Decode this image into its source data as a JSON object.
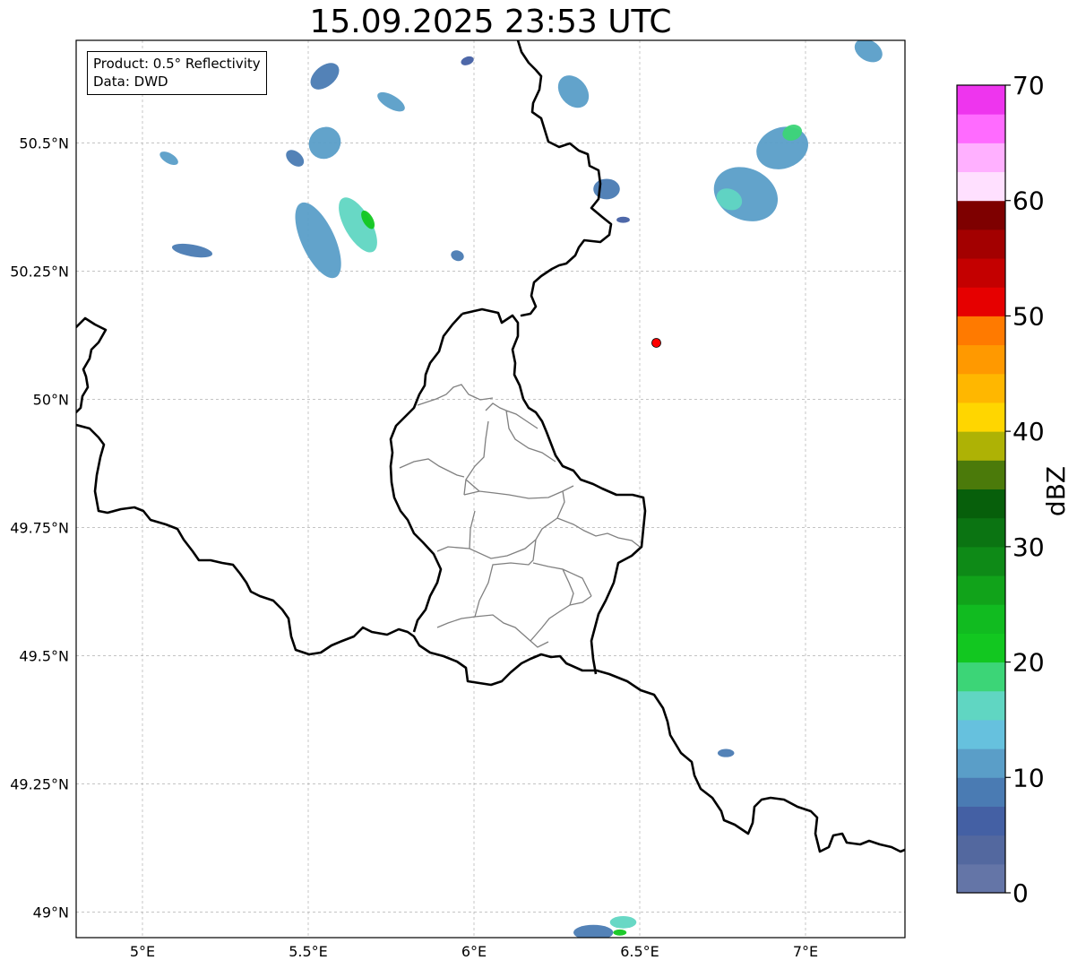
{
  "title": "15.09.2025 23:53 UTC",
  "info_box": {
    "product": "Product: 0.5° Reflectivity",
    "data_source": "Data: DWD"
  },
  "map": {
    "extent": {
      "lon_min": 4.8,
      "lon_max": 7.3,
      "lat_min": 48.95,
      "lat_max": 50.7
    },
    "lat_ticks": [
      {
        "value": 49.0,
        "label": "49°N"
      },
      {
        "value": 49.25,
        "label": "49.25°N"
      },
      {
        "value": 49.5,
        "label": "49.5°N"
      },
      {
        "value": 49.75,
        "label": "49.75°N"
      },
      {
        "value": 50.0,
        "label": "50°N"
      },
      {
        "value": 50.25,
        "label": "50.25°N"
      },
      {
        "value": 50.5,
        "label": "50.5°N"
      }
    ],
    "lon_ticks": [
      {
        "value": 5.0,
        "label": "5°E"
      },
      {
        "value": 5.5,
        "label": "5.5°E"
      },
      {
        "value": 6.0,
        "label": "6°E"
      },
      {
        "value": 6.5,
        "label": "6.5°E"
      },
      {
        "value": 7.0,
        "label": "7°E"
      }
    ],
    "radar_site": {
      "lon": 6.55,
      "lat": 50.11,
      "color": "#ff0000"
    },
    "colors": {
      "border": "#000000",
      "admin_border": "#808080",
      "grid": "#b0b0b0"
    },
    "echoes": [
      {
        "lon": 5.08,
        "lat": 50.47,
        "rlon": 0.015,
        "rlat": 0.02,
        "rot": -60,
        "dbz": 10
      },
      {
        "lon": 5.15,
        "lat": 50.29,
        "rlon": 0.018,
        "rlat": 0.04,
        "rot": -80,
        "dbz": 8
      },
      {
        "lon": 5.46,
        "lat": 50.47,
        "rlon": 0.02,
        "rlat": 0.02,
        "rot": -50,
        "dbz": 9
      },
      {
        "lon": 5.55,
        "lat": 50.5,
        "rlon": 0.05,
        "rlat": 0.03,
        "rot": -45,
        "dbz": 12
      },
      {
        "lon": 5.53,
        "lat": 50.31,
        "rlon": 0.05,
        "rlat": 0.08,
        "rot": -25,
        "dbz": 11
      },
      {
        "lon": 5.65,
        "lat": 50.34,
        "rlon": 0.04,
        "rlat": 0.06,
        "rot": -30,
        "dbz": 15
      },
      {
        "lon": 5.68,
        "lat": 50.35,
        "rlon": 0.015,
        "rlat": 0.02,
        "rot": -30,
        "dbz": 22
      },
      {
        "lon": 5.55,
        "lat": 50.63,
        "rlon": 0.05,
        "rlat": 0.02,
        "rot": -40,
        "dbz": 8
      },
      {
        "lon": 5.75,
        "lat": 50.58,
        "rlon": 0.02,
        "rlat": 0.03,
        "rot": -60,
        "dbz": 12
      },
      {
        "lon": 5.98,
        "lat": 50.66,
        "rlon": 0.02,
        "rlat": 0.008,
        "rot": -20,
        "dbz": 7
      },
      {
        "lon": 5.95,
        "lat": 50.28,
        "rlon": 0.02,
        "rlat": 0.01,
        "rot": 20,
        "dbz": 8
      },
      {
        "lon": 6.3,
        "lat": 50.6,
        "rlon": 0.04,
        "rlat": 0.035,
        "rot": -40,
        "dbz": 10
      },
      {
        "lon": 6.4,
        "lat": 50.41,
        "rlon": 0.04,
        "rlat": 0.02,
        "rot": 0,
        "dbz": 9
      },
      {
        "lon": 6.45,
        "lat": 50.35,
        "rlon": 0.02,
        "rlat": 0.006,
        "rot": 0,
        "dbz": 6
      },
      {
        "lon": 6.82,
        "lat": 50.4,
        "rlon": 0.1,
        "rlat": 0.05,
        "rot": 25,
        "dbz": 10
      },
      {
        "lon": 6.77,
        "lat": 50.39,
        "rlon": 0.04,
        "rlat": 0.02,
        "rot": 25,
        "dbz": 16
      },
      {
        "lon": 6.93,
        "lat": 50.49,
        "rlon": 0.08,
        "rlat": 0.04,
        "rot": -20,
        "dbz": 11
      },
      {
        "lon": 6.96,
        "lat": 50.52,
        "rlon": 0.03,
        "rlat": 0.015,
        "rot": -20,
        "dbz": 18
      },
      {
        "lon": 7.19,
        "lat": 50.68,
        "rlon": 0.045,
        "rlat": 0.02,
        "rot": 30,
        "dbz": 12
      },
      {
        "lon": 6.76,
        "lat": 49.31,
        "rlon": 0.025,
        "rlat": 0.008,
        "rot": 0,
        "dbz": 8
      },
      {
        "lon": 6.36,
        "lat": 48.96,
        "rlon": 0.06,
        "rlat": 0.015,
        "rot": 0,
        "dbz": 9
      },
      {
        "lon": 6.45,
        "lat": 48.98,
        "rlon": 0.04,
        "rlat": 0.012,
        "rot": 0,
        "dbz": 16
      },
      {
        "lon": 6.44,
        "lat": 48.96,
        "rlon": 0.02,
        "rlat": 0.006,
        "rot": 0,
        "dbz": 22
      }
    ]
  },
  "colorbar": {
    "label": "dBZ",
    "min": 0,
    "max": 70,
    "step": 2.5,
    "ticks": [
      {
        "value": 0,
        "label": "0"
      },
      {
        "value": 10,
        "label": "10"
      },
      {
        "value": 20,
        "label": "20"
      },
      {
        "value": 30,
        "label": "30"
      },
      {
        "value": 40,
        "label": "40"
      },
      {
        "value": 50,
        "label": "50"
      },
      {
        "value": 60,
        "label": "60"
      },
      {
        "value": 70,
        "label": "70"
      }
    ],
    "colors": [
      "#6475a7",
      "#53689f",
      "#4460a4",
      "#4a7bb3",
      "#5a9ec8",
      "#66c1de",
      "#60d6c2",
      "#3cd577",
      "#12c720",
      "#11bb20",
      "#11a31a",
      "#0e8a17",
      "#0b7412",
      "#075f0b",
      "#4b7a0a",
      "#aeb205",
      "#ffd600",
      "#ffb700",
      "#ff9900",
      "#ff7a00",
      "#e60000",
      "#c40000",
      "#a30000",
      "#7e0000",
      "#ffe0ff",
      "#ffb0ff",
      "#ff6bff",
      "#ee35ee"
    ]
  }
}
